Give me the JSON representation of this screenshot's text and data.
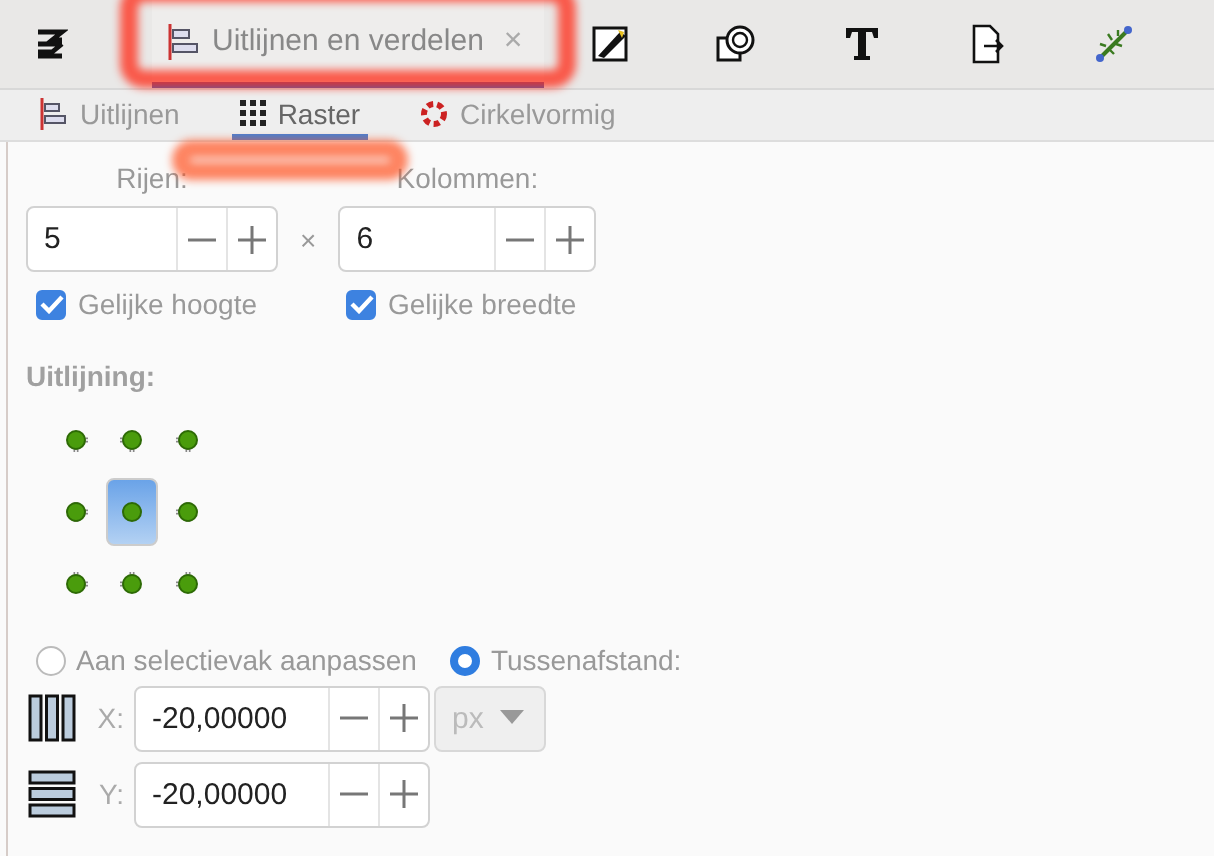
{
  "main_tab": {
    "label": "Uitlijnen en verdelen",
    "close": "×",
    "selected": true
  },
  "sub_tabs": [
    {
      "label": "Uitlijnen",
      "selected": false
    },
    {
      "label": "Raster",
      "selected": true
    },
    {
      "label": "Cirkelvormig",
      "selected": false
    }
  ],
  "rows": {
    "label": "Rijen:",
    "value": "5",
    "equal": {
      "label": "Gelijke hoogte",
      "checked": true
    }
  },
  "times": "×",
  "columns": {
    "label": "Kolommen:",
    "value": "6",
    "equal": {
      "label": "Gelijke breedte",
      "checked": true
    }
  },
  "alignment": {
    "title": "Uitlijning:",
    "anchors": [
      {
        "selected": false
      },
      {
        "selected": false
      },
      {
        "selected": false
      },
      {
        "selected": false
      },
      {
        "selected": true
      },
      {
        "selected": false
      },
      {
        "selected": false
      },
      {
        "selected": false
      },
      {
        "selected": false
      }
    ]
  },
  "fit_options": [
    {
      "label": "Aan selectievak aanpassen",
      "selected": false
    },
    {
      "label": "Tussenafstand:",
      "selected": true
    }
  ],
  "spacing": [
    {
      "kind": "x",
      "label": "X:",
      "value": "-20,00000"
    },
    {
      "kind": "y",
      "label": "Y:",
      "value": "-20,00000"
    }
  ],
  "unit": "px"
}
